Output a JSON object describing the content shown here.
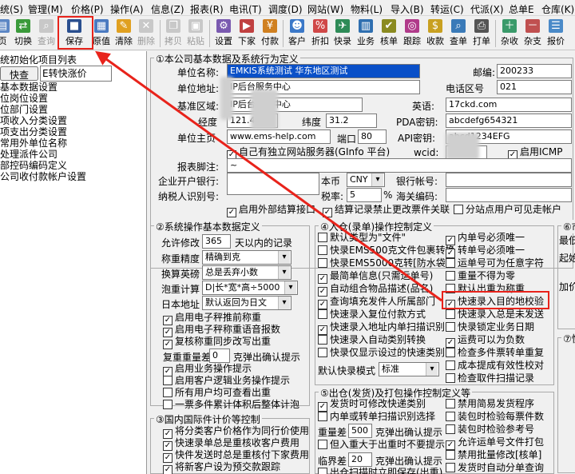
{
  "menu": [
    "统(S)",
    "管理(M)",
    "价格(P)",
    "操作(A)",
    "信息(Z)",
    "报表(R)",
    "电讯(T)",
    "调度(D)",
    "网站(W)",
    "物料(L)",
    "导入(B)",
    "转运(C)",
    "代派(X)",
    "总单E",
    "仓库(K)"
  ],
  "toolbar": {
    "page": "页",
    "switch": "切换",
    "query": "查询",
    "save": "保存",
    "restore": "原值",
    "clear": "清除",
    "delete": "删除",
    "copy": "拷贝",
    "paste": "粘贴",
    "settings": "设置",
    "order": "下家",
    "payment": "付款",
    "customer": "客户",
    "discount": "折扣",
    "express": "快录",
    "business": "业务",
    "verify": "核单",
    "track": "跟踪",
    "receivable": "收款",
    "check_order": "查单",
    "print": "打单",
    "misc": "杂收",
    "misc_send": "杂支",
    "report": "报价"
  },
  "left": {
    "title": "统初始化项目列表",
    "search_btn": "快查",
    "search_value": "E转快涨价",
    "items": [
      "基本数据设置",
      "位岗位设置",
      "位部门设置",
      "项收入分类设置",
      "项支出分类设置",
      "常用外单位名称",
      "处理派件公司",
      "部控码编码定义",
      "公司收付款帐户设置"
    ]
  },
  "s1": {
    "title": "①本公司基本数据及系统行为定义",
    "unit_name_l": "单位名称:",
    "unit_name_v": "EMKIS系统测试 华东地区测试",
    "zip_l": "邮编:",
    "zip_v": "200233",
    "addr_l": "单位地址:",
    "addr_v": "IP后台服务中心",
    "area_l": "电话区号",
    "area_v": "021",
    "region_l": "基准区域:",
    "region_v": "IP后台服务中心",
    "eng_l": "英语:",
    "eng_v": "17ckd.com",
    "lng_l": "经度",
    "lng_v": "121.4",
    "lat_l": "纬度",
    "lat_v": "31.2",
    "pda_l": "PDA密钥:",
    "pda_v": "abcdefg654321",
    "site_l": "单位主页",
    "site_v": "www.ems-help.com",
    "port_l": "端口",
    "port_v": "80",
    "api_l": "API密钥:",
    "api_v": "abcd1234EFG",
    "ownsrv": "自己有独立网站服务器(GInfo 平台)",
    "wcid_l": "wcid:",
    "icmp": "启用ICMP",
    "footer_l": "报表脚注:",
    "footer_v": "~",
    "bank_l": "企业开户银行:",
    "currency_l": "本币",
    "currency_v": "CNY",
    "bankacct_l": "银行帐号:",
    "taxid_l": "纳税人识别号:",
    "tax_l": "税率:",
    "tax_v": "5",
    "pct": "%",
    "customs_l": "海关编码:",
    "ext_settle": "启用外部结算接口",
    "settle_ban": "结算记录禁止更改票件关联",
    "branch_hide": "分站点用户可见走帐户"
  },
  "s2": {
    "title": "②系统操作基本数据定义",
    "allow_l": "允许修改",
    "allow_v": "365",
    "allow_r": "天以内的记录",
    "prec_l": "称重精度",
    "prec_v": "精确到克",
    "round_l": "换算英磅",
    "round_v": "总是丢弃小数",
    "bubble_l": "泡重计算",
    "bubble_v": "D|长*宽*高÷5000",
    "jp_l": "日本地址",
    "jp_v": "默认返回为日文",
    "c1": "启用电子秤推前称重",
    "c2": "启用电子秤称重语音报数",
    "c3": "复核称重同步改写出重",
    "reweigh_l": "复重重量差",
    "reweigh_v": "0",
    "reweigh_r": "克弹出确认提示",
    "c4": "启用业务操作提示",
    "c5": "启用客户逻辑业务操作提示",
    "c6": "所有用户均可查看出重",
    "c7": "一票多件累计体积后整体计泡"
  },
  "s3": {
    "title": "③国内国际件计价等控制",
    "c1": "将分类客户价格作为同行价使用",
    "c2": "快速录单总是重核收客户费用",
    "c3": "快件发送时总是重核付下家费用",
    "c4": "将新客户设为预交款跟踪"
  },
  "s4": {
    "title": "④入仓(录单)操作控制定义",
    "l1": "默认类型为\"文件\"",
    "l2": "快录EMS500克文件包裹转换",
    "l3": "快录EMS5000克转[防水袋]",
    "l4": "最简单信息(只需运单号)",
    "l5": "自动组合物品描述(品名)",
    "l6": "查询填充发件人所属部门",
    "l7": "快速录入复位付款方式",
    "l8": "快速录入地址内单扫描识别",
    "l9": "快速录入自动类别转换",
    "l10": "快录仅显示设过的快速类别",
    "mode_l": "默认快录模式",
    "mode_v": "标准",
    "r1": "内单号必须唯一",
    "r2": "转单号必须唯一",
    "r3": "运单号可为任意字符",
    "r4": "重量不得为零",
    "r5": "默认出重为称重",
    "r6": "快速录入目的地校验",
    "r7": "快速录入总是未发送",
    "r8": "快录锁定业务日期",
    "r9": "运费可以为负数",
    "r10": "检查多件票转单重复",
    "r11": "成本提成有效性校对",
    "r12": "检查取件扫描记录"
  },
  "s5": {
    "title": "⑤出仓(发货)及打包操作控制定义等",
    "l1": "发货时可修改快递类别",
    "l2": "内单或转单扫描识别选择",
    "dw_l": "重量差",
    "dw_v": "500",
    "dw_r": "克弹出确认提示",
    "l3": "但入重大于出重时不要提示",
    "cr_l": "临界差",
    "cr_v": "20",
    "cr_r": "克弹出确认提示",
    "l4": "出仓扫描时立即保存(出重)",
    "r1": "禁用简易发货程序",
    "r2": "装包时检验每票件数",
    "r3": "装包时检验参考号",
    "r4": "允许运单号文件打包",
    "r5": "禁用批量修改[核单]",
    "r6": "发货时自动分单查询"
  },
  "s6": {
    "a": "⑥市",
    "b": "最低",
    "c": "起始",
    "d": "加价"
  },
  "s7": {
    "a": "⑦快"
  }
}
